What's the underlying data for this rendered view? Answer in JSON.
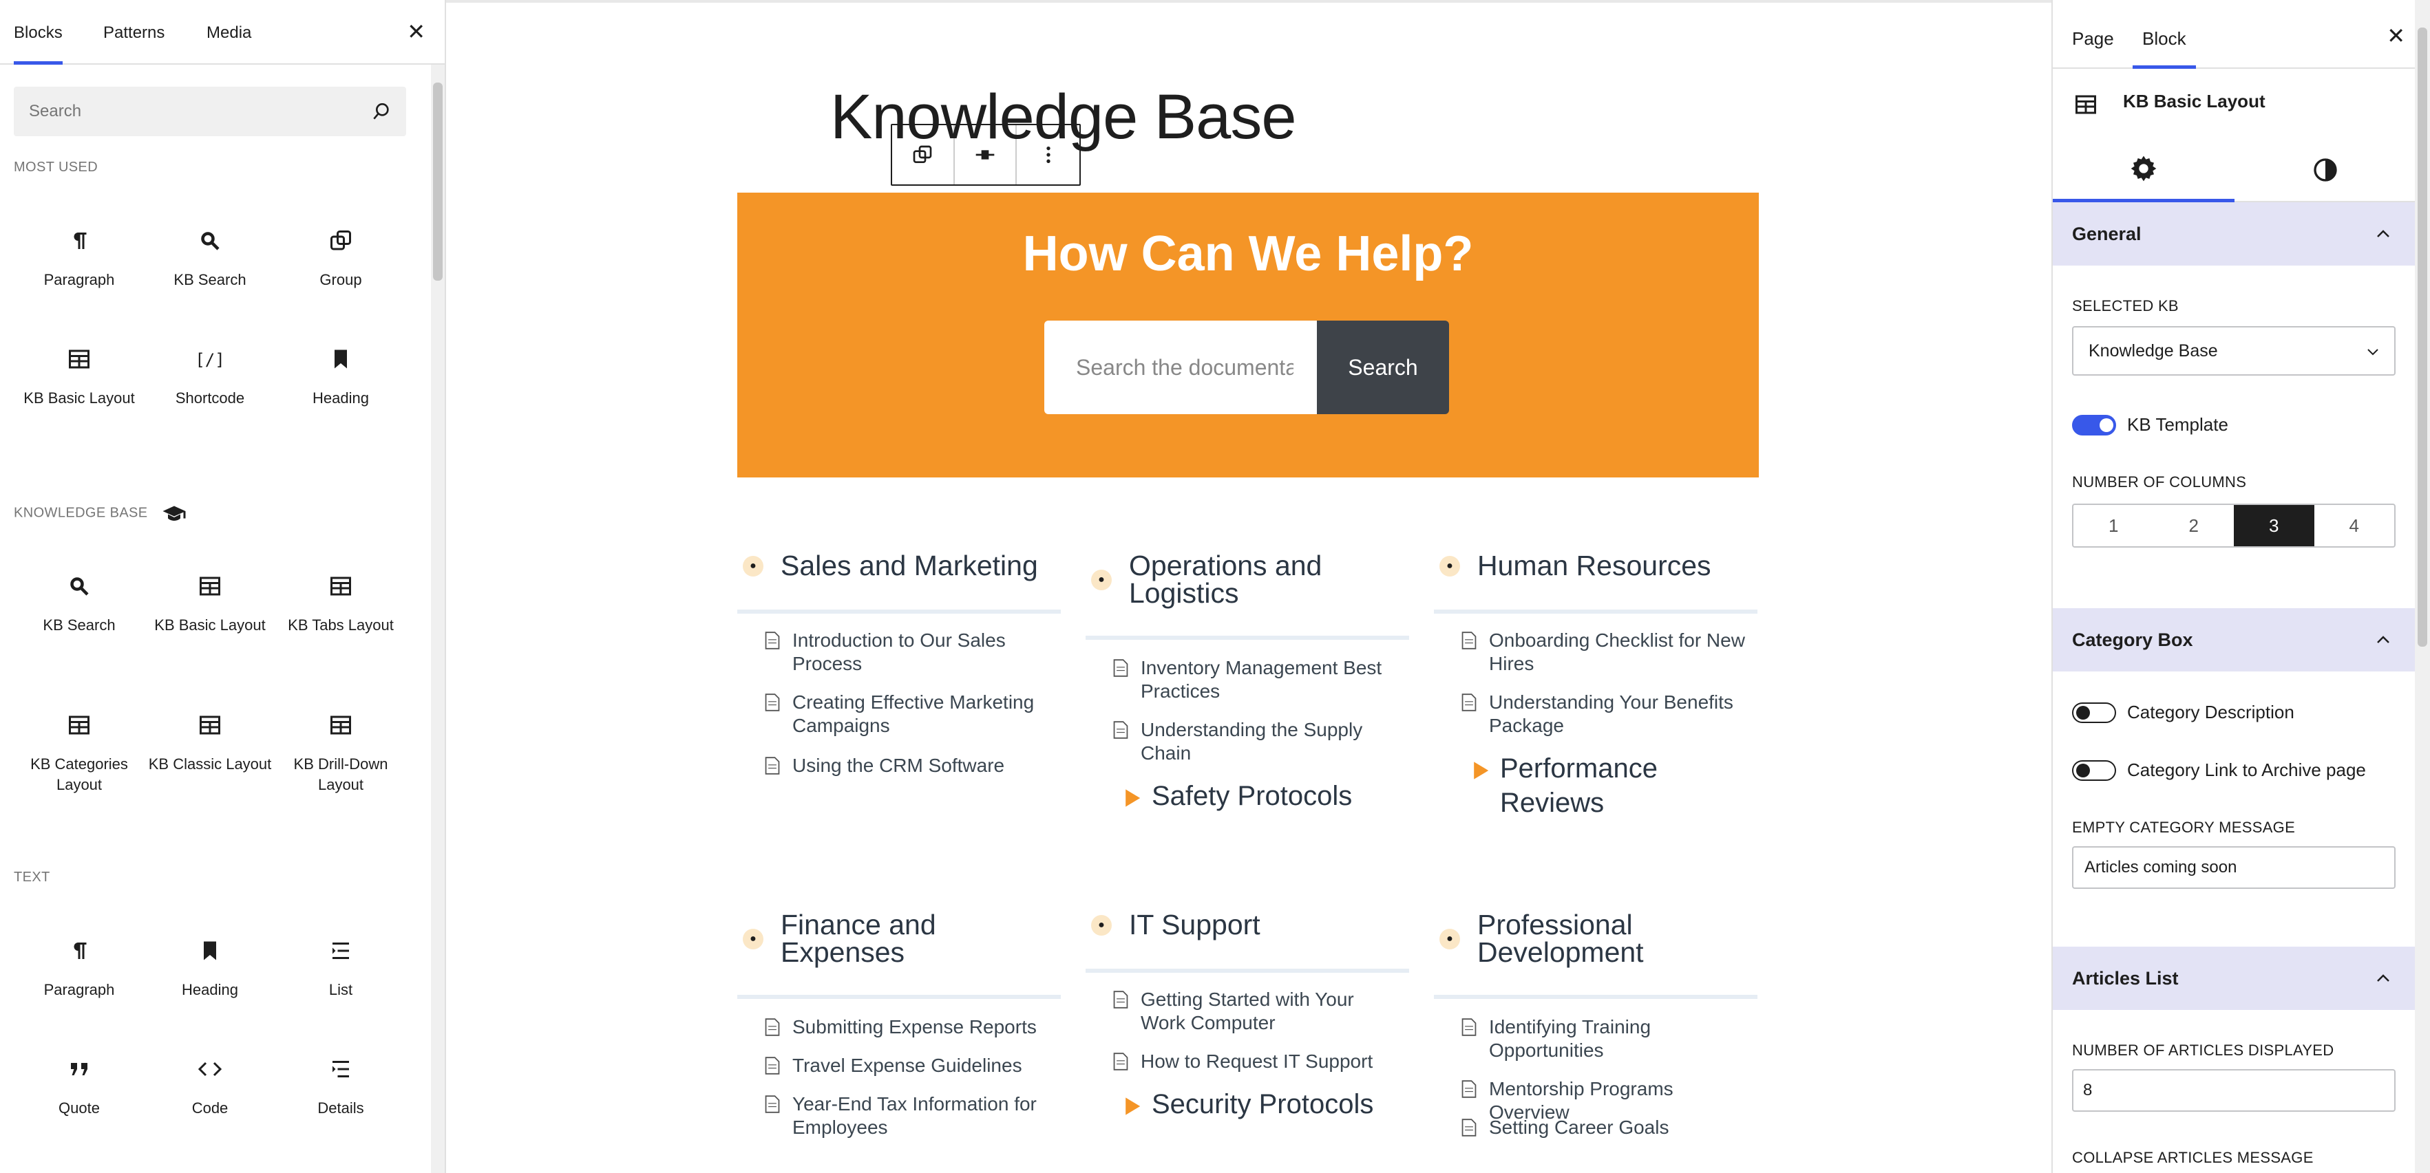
{
  "left_panel": {
    "tabs": [
      "Blocks",
      "Patterns",
      "Media"
    ],
    "close_icon": "close-icon",
    "search": {
      "placeholder": "Search"
    },
    "sections": {
      "most_used": "MOST USED",
      "knowledge_base": "KNOWLEDGE BASE",
      "text": "TEXT"
    },
    "most_used_blocks": [
      {
        "label": "Paragraph",
        "icon": "paragraph-icon"
      },
      {
        "label": "KB Search",
        "icon": "search-icon"
      },
      {
        "label": "Group",
        "icon": "group-icon"
      },
      {
        "label": "KB Basic Layout",
        "icon": "table-icon"
      },
      {
        "label": "Shortcode",
        "icon": "shortcode-icon"
      },
      {
        "label": "Heading",
        "icon": "bookmark-icon"
      }
    ],
    "kb_blocks": [
      {
        "label": "KB Search",
        "icon": "search-icon"
      },
      {
        "label": "KB Basic Layout",
        "icon": "table-icon"
      },
      {
        "label": "KB Tabs Layout",
        "icon": "table-icon"
      },
      {
        "label": "KB Categories Layout",
        "icon": "table-icon"
      },
      {
        "label": "KB Classic Layout",
        "icon": "table-icon"
      },
      {
        "label": "KB Drill-Down Layout",
        "icon": "table-icon"
      }
    ],
    "text_blocks": [
      {
        "label": "Paragraph",
        "icon": "paragraph-icon"
      },
      {
        "label": "Heading",
        "icon": "bookmark-icon"
      },
      {
        "label": "List",
        "icon": "list-icon"
      },
      {
        "label": "Quote",
        "icon": "quote-icon"
      },
      {
        "label": "Code",
        "icon": "code-icon"
      },
      {
        "label": "Details",
        "icon": "details-icon"
      }
    ]
  },
  "canvas": {
    "page_title": "Knowledge Base",
    "hero": {
      "heading": "How Can We Help?",
      "search_placeholder": "Search the documentation...",
      "search_button": "Search",
      "color": "#f49527"
    },
    "categories": [
      {
        "title": "Sales and Marketing",
        "articles": [
          "Introduction to Our Sales Process",
          "Creating Effective Marketing Campaigns",
          "Using the CRM Software"
        ],
        "folders": []
      },
      {
        "title": "Operations and Logistics",
        "articles": [
          "Inventory Management Best Practices",
          "Understanding the Supply Chain"
        ],
        "folders": [
          "Safety Protocols"
        ]
      },
      {
        "title": "Human Resources",
        "articles": [
          "Onboarding Checklist for New Hires",
          "Understanding Your Benefits Package"
        ],
        "folders": [
          "Performance Reviews"
        ]
      },
      {
        "title": "Finance and Expenses",
        "articles": [
          "Submitting Expense Reports",
          "Travel Expense Guidelines",
          "Year-End Tax Information for Employees"
        ],
        "folders": []
      },
      {
        "title": "IT Support",
        "articles": [
          "Getting Started with Your Work Computer",
          "How to Request IT Support"
        ],
        "folders": [
          "Security Protocols"
        ]
      },
      {
        "title": "Professional Development",
        "articles": [
          "Identifying Training Opportunities",
          "Mentorship Programs Overview",
          "Setting Career Goals"
        ],
        "folders": []
      }
    ]
  },
  "right_panel": {
    "tabs": [
      "Page",
      "Block"
    ],
    "block_name": "KB Basic Layout",
    "general": {
      "title": "General",
      "selected_kb_label": "SELECTED KB",
      "selected_kb_value": "Knowledge Base",
      "kb_template_label": "KB Template",
      "kb_template_on": true,
      "columns_label": "NUMBER OF COLUMNS",
      "columns": [
        "1",
        "2",
        "3",
        "4"
      ],
      "columns_selected": "3"
    },
    "category_box": {
      "title": "Category Box",
      "description_label": "Category Description",
      "archive_link_label": "Category Link to Archive page",
      "empty_message_label": "EMPTY CATEGORY MESSAGE",
      "empty_message_value": "Articles coming soon"
    },
    "articles_list": {
      "title": "Articles List",
      "count_label": "NUMBER OF ARTICLES DISPLAYED",
      "count_value": "8",
      "collapse_label": "COLLAPSE ARTICLES MESSAGE"
    }
  }
}
